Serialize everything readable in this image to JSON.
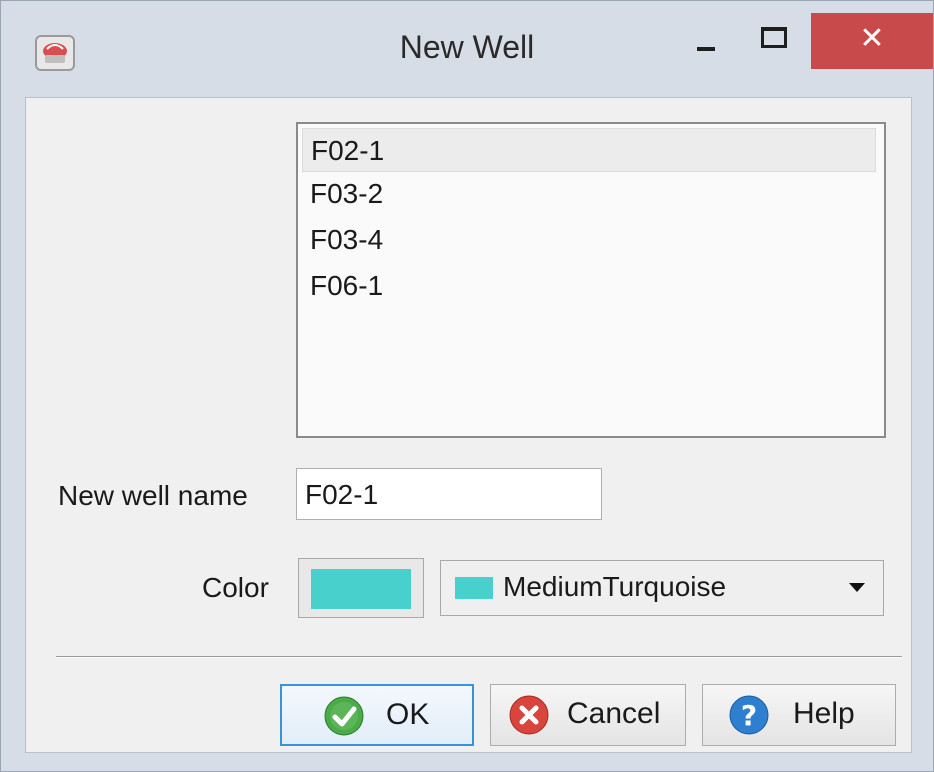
{
  "window": {
    "title": "New Well",
    "close_glyph": "✕"
  },
  "wells_list": {
    "items": [
      "F02-1",
      "F03-2",
      "F03-4",
      "F06-1"
    ],
    "selected_index": 0
  },
  "form": {
    "name_label": "New well name",
    "name_value": "F02-1",
    "color_label": "Color",
    "color_name": "MediumTurquoise",
    "color_hex": "#48d1cc"
  },
  "buttons": {
    "ok": "OK",
    "cancel": "Cancel",
    "help": "Help"
  },
  "icons": {
    "app": "well-app-icon",
    "ok": "check-circle-icon",
    "cancel": "cancel-circle-icon",
    "help": "help-circle-icon"
  },
  "colors": {
    "close_button": "#c84a4a",
    "ok_icon": "#4bab48",
    "cancel_icon": "#d9443c",
    "help_icon": "#2f7fd0",
    "ok_border": "#3c92d8"
  }
}
